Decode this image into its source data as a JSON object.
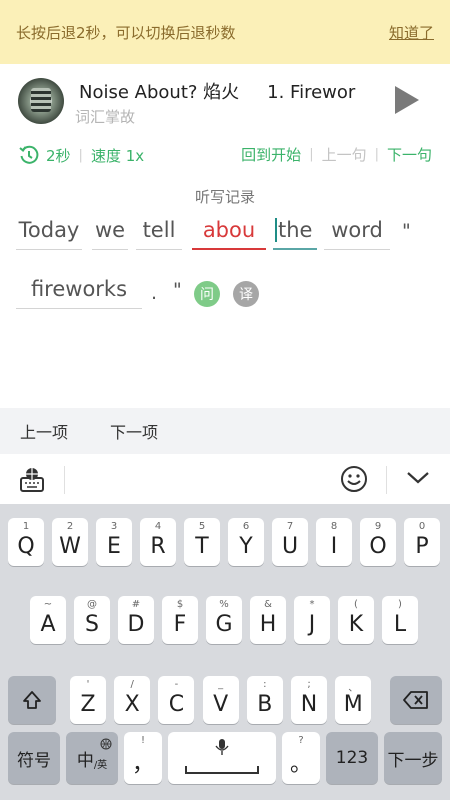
{
  "banner": {
    "message": "长按后退2秒，可以切换后退秒数",
    "dismiss_label": "知道了"
  },
  "track": {
    "title": "Noise About? 焰火",
    "part": "1. Firewor",
    "subtitle": "词汇掌故"
  },
  "controls": {
    "rewind_seconds": "2秒",
    "speed": "速度 1x",
    "restart": "回到开始",
    "prev_sentence": "上一句",
    "next_sentence": "下一句"
  },
  "dictation": {
    "label": "听写记录",
    "words": [
      "Today",
      "we",
      "tell",
      "abou",
      "the",
      "word",
      "fireworks"
    ],
    "quote_open": "\"",
    "period": ".",
    "quote_close": "\"",
    "ask_badge": "问",
    "translate_badge": "译"
  },
  "nav": {
    "prev_item": "上一项",
    "next_item": "下一项"
  },
  "keyboard": {
    "row1": [
      [
        "1",
        "Q"
      ],
      [
        "2",
        "W"
      ],
      [
        "3",
        "E"
      ],
      [
        "4",
        "R"
      ],
      [
        "5",
        "T"
      ],
      [
        "6",
        "Y"
      ],
      [
        "7",
        "U"
      ],
      [
        "8",
        "I"
      ],
      [
        "9",
        "O"
      ],
      [
        "0",
        "P"
      ]
    ],
    "row2": [
      [
        "~",
        "A"
      ],
      [
        "@",
        "S"
      ],
      [
        "#",
        "D"
      ],
      [
        "$",
        "F"
      ],
      [
        "%",
        "G"
      ],
      [
        "&",
        "H"
      ],
      [
        "*",
        "J"
      ],
      [
        "(",
        "K"
      ],
      [
        ")",
        "L"
      ]
    ],
    "row3": [
      [
        "'",
        "Z"
      ],
      [
        "/",
        "X"
      ],
      [
        "-",
        "C"
      ],
      [
        "_",
        "V"
      ],
      [
        ":",
        "B"
      ],
      [
        ";",
        "N"
      ],
      [
        "、",
        "M"
      ]
    ],
    "symbol_key": "符号",
    "lang_key": "中",
    "lang_sub": "/英",
    "comma_sub": "!",
    "comma": "，",
    "period_sub": "?",
    "period": "。",
    "num_key": "123",
    "next_step": "下一步"
  },
  "colors": {
    "accent_green": "#3bb36a",
    "error_red": "#d8393a",
    "banner_bg": "#fbf0b8"
  }
}
